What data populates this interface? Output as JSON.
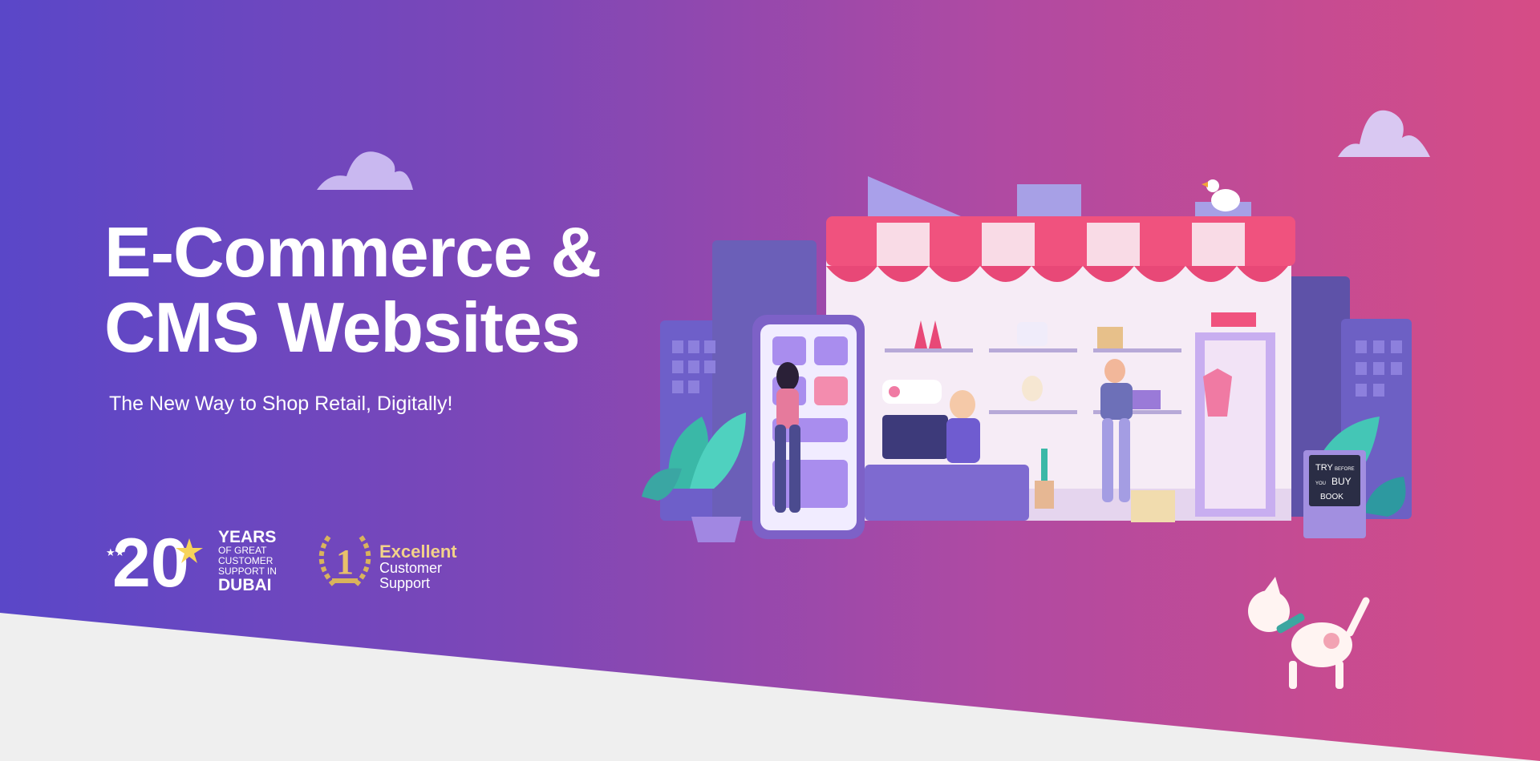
{
  "hero": {
    "headline_line1": "E-Commerce &",
    "headline_line2": "CMS Websites",
    "subtitle": "The New Way to Shop Retail, Digitally!"
  },
  "badges": {
    "years_number": "20",
    "years_title": "YEARS",
    "years_line2": "OF GREAT",
    "years_line3": "CUSTOMER",
    "years_line4": "SUPPORT IN",
    "years_city": "DUBAI",
    "award_number": "1",
    "award_title": "Excellent",
    "award_line2": "Customer",
    "award_line3": "Support"
  },
  "illustration": {
    "sign_line1": "TRY",
    "sign_line1b": "BEFORE",
    "sign_line2a": "YOU",
    "sign_line2b": "BUY",
    "sign_line3": "BOOK"
  },
  "colors": {
    "gradient_start": "#5a47c8",
    "gradient_end": "#d64c86",
    "award_gold": "#f3d28a",
    "bottom_band": "#efefef"
  }
}
